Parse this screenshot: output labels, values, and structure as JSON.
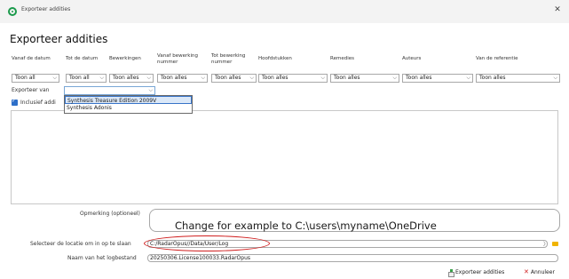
{
  "window": {
    "title": "Exporteer addities",
    "close_glyph": "✕"
  },
  "page_title": "Exporteer addities",
  "columns": [
    "Vanaf de datum",
    "Tot de datum",
    "Bewerkingen",
    "Vanaf bewerking nummer",
    "Tot bewerking nummer",
    "Hoofdstukken",
    "Remedies",
    "Auteurs",
    "Van de referentie"
  ],
  "filters": [
    "Toon all",
    "Toon all",
    "Toon alles",
    "Toon alles",
    "Toon alles",
    "Toon alles",
    "Toon alles",
    "Toon alles",
    "Toon alles"
  ],
  "export_from": {
    "label": "Exporteer van",
    "value": "",
    "options": [
      "Synthesis Treasure Edition 2009V",
      "Synthesis Adonis"
    ]
  },
  "include_checkbox": {
    "label": "Inclusief addi",
    "checked": true
  },
  "remarks": {
    "label": "Opmerking (optioneel)",
    "value": ""
  },
  "annotation_text": "Change for example to  C:\\users\\myname\\OneDrive",
  "save_location": {
    "label": "Selecteer de locatie om in op te slaan",
    "value": "C:/RadarOpus//Data/User/Log"
  },
  "log_file": {
    "label": "Naam van het logbestand",
    "value": "20250306.License100033.RadarOpus"
  },
  "buttons": {
    "export": "Exporteer addities",
    "cancel": "Annuleer"
  },
  "colors": {
    "annotation_ellipse": "#d01e1e",
    "accent": "#2d6fc9",
    "app_icon": "#1a9a4b"
  }
}
